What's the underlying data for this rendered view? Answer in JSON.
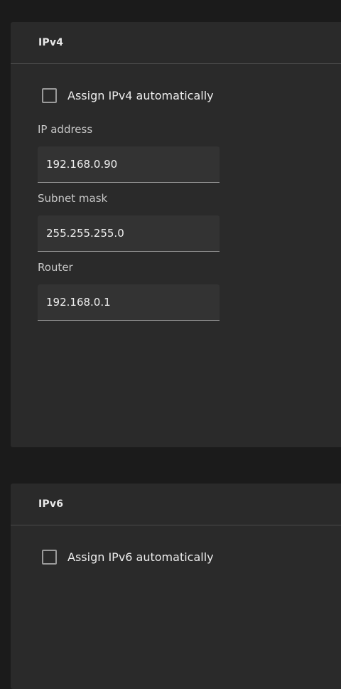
{
  "ipv4": {
    "title": "IPv4",
    "auto_label": "Assign IPv4 automatically",
    "auto_checked": false,
    "fields": {
      "ip_address": {
        "label": "IP address",
        "value": "192.168.0.90"
      },
      "subnet_mask": {
        "label": "Subnet mask",
        "value": "255.255.255.0"
      },
      "router": {
        "label": "Router",
        "value": "192.168.0.1"
      }
    }
  },
  "ipv6": {
    "title": "IPv6",
    "auto_label": "Assign IPv6 automatically",
    "auto_checked": false
  }
}
